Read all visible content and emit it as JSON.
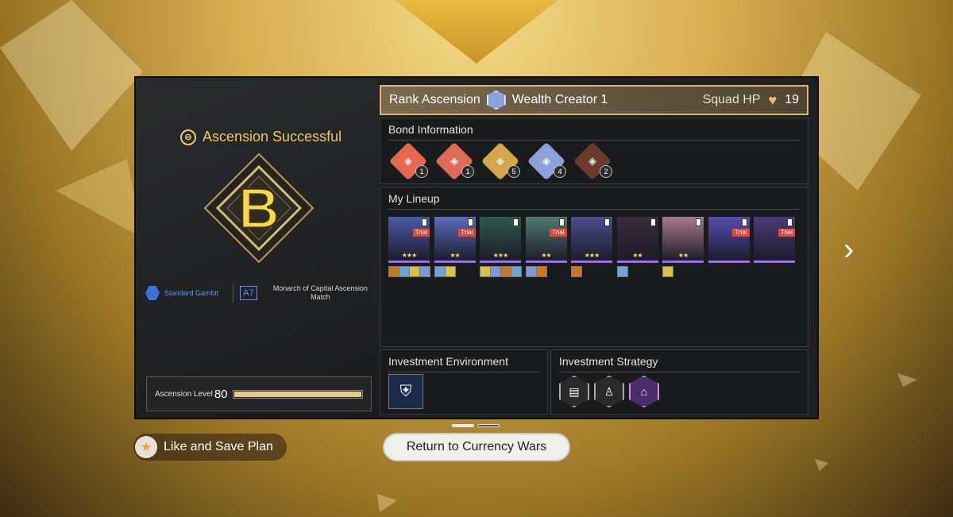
{
  "result": {
    "title": "Ascension Successful",
    "grade": "B",
    "gambit_label": "Standard Gambit",
    "ascension_tag": "A7",
    "mode_label": "Monarch of Capital Ascension Match",
    "level_label": "Ascension Level",
    "level_value": "80",
    "level_progress": 1.0
  },
  "rank": {
    "label": "Rank Ascension",
    "name": "Wealth Creator 1",
    "hp_label": "Squad HP",
    "hp_value": "19"
  },
  "bonds": {
    "title": "Bond Information",
    "items": [
      {
        "icon": "bond-card-icon",
        "count": "1",
        "color": "#e8674f"
      },
      {
        "icon": "bond-glyph-icon",
        "count": "1",
        "color": "#e06a58"
      },
      {
        "icon": "bond-bell-icon",
        "count": "5",
        "color": "#d4a64a"
      },
      {
        "icon": "bond-shield-icon",
        "count": "4",
        "color": "#8da2d8"
      },
      {
        "icon": "bond-triad-icon",
        "count": "2",
        "color": "#6a3a2a"
      }
    ]
  },
  "lineup": {
    "title": "My Lineup",
    "characters": [
      {
        "name": "character-1",
        "trial": "Trial",
        "color": "#4b5aa8",
        "stars": "★★★",
        "relics": 4
      },
      {
        "name": "character-2",
        "trial": "Trial",
        "color": "#5b6dbf",
        "stars": "★★",
        "relics": 2
      },
      {
        "name": "character-3",
        "trial": "",
        "color": "#2e5a4b",
        "stars": "★★★",
        "relics": 4
      },
      {
        "name": "character-4",
        "trial": "Trial",
        "color": "#4f7a72",
        "stars": "★★",
        "relics": 2
      },
      {
        "name": "character-5",
        "trial": "",
        "color": "#4a4e8c",
        "stars": "★★★",
        "relics": 1
      },
      {
        "name": "character-6",
        "trial": "",
        "color": "#3b2a3a",
        "stars": "★★",
        "relics": 1
      },
      {
        "name": "character-7",
        "trial": "",
        "color": "#a87a8c",
        "stars": "★★",
        "relics": 1
      },
      {
        "name": "character-8",
        "trial": "Trial",
        "color": "#5a4cb0",
        "stars": "",
        "relics": 0
      },
      {
        "name": "character-9",
        "trial": "Trial",
        "color": "#4a3a78",
        "stars": "",
        "relics": 0
      }
    ]
  },
  "environment": {
    "title": "Investment Environment",
    "icon": "environment-icon"
  },
  "strategy": {
    "title": "Investment Strategy",
    "items": [
      {
        "icon": "strategy-document-icon"
      },
      {
        "icon": "strategy-figure-icon"
      },
      {
        "icon": "strategy-shop-icon"
      }
    ]
  },
  "buttons": {
    "like_label": "Like and Save Plan",
    "return_label": "Return to Currency Wars"
  }
}
